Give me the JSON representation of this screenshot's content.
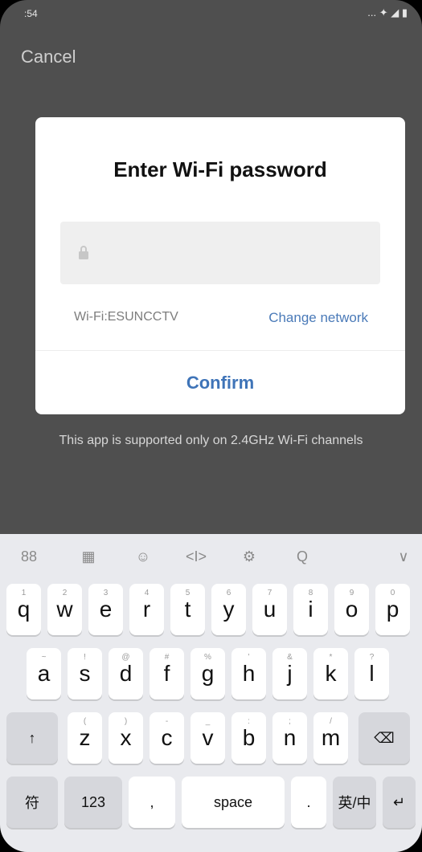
{
  "status": {
    "time": ":54",
    "right": "... ✦ ◢ ▮"
  },
  "top": {
    "cancel": "Cancel"
  },
  "dialog": {
    "title": "Enter Wi-Fi password",
    "password_placeholder": "",
    "wifi_label": "Wi-Fi:ESUNCCTV",
    "change_network": "Change network",
    "confirm": "Confirm"
  },
  "notice": "This app is supported only on 2.4GHz Wi-Fi channels",
  "keyboard": {
    "tools": [
      "88",
      "▦",
      "☺",
      "<I>",
      "⚙",
      "Q",
      "∨"
    ],
    "row1": [
      {
        "hint": "1",
        "label": "q"
      },
      {
        "hint": "2",
        "label": "w"
      },
      {
        "hint": "3",
        "label": "e"
      },
      {
        "hint": "4",
        "label": "r"
      },
      {
        "hint": "5",
        "label": "t"
      },
      {
        "hint": "6",
        "label": "y"
      },
      {
        "hint": "7",
        "label": "u"
      },
      {
        "hint": "8",
        "label": "i"
      },
      {
        "hint": "9",
        "label": "o"
      },
      {
        "hint": "0",
        "label": "p"
      }
    ],
    "row2": [
      {
        "hint": "~",
        "label": "a"
      },
      {
        "hint": "!",
        "label": "s"
      },
      {
        "hint": "@",
        "label": "d"
      },
      {
        "hint": "#",
        "label": "f"
      },
      {
        "hint": "%",
        "label": "g"
      },
      {
        "hint": "'",
        "label": "h"
      },
      {
        "hint": "&",
        "label": "j"
      },
      {
        "hint": "*",
        "label": "k"
      },
      {
        "hint": "?",
        "label": "l"
      }
    ],
    "row3": [
      {
        "hint": "",
        "label": "↑"
      },
      {
        "hint": "(",
        "label": "z"
      },
      {
        "hint": ")",
        "label": "x"
      },
      {
        "hint": "-",
        "label": "c"
      },
      {
        "hint": "_",
        "label": "v"
      },
      {
        "hint": ":",
        "label": "b"
      },
      {
        "hint": ";",
        "label": "n"
      },
      {
        "hint": "/",
        "label": "m"
      },
      {
        "hint": "",
        "label": "⌫"
      }
    ],
    "row4": [
      {
        "label": "符"
      },
      {
        "label": "123"
      },
      {
        "label": ","
      },
      {
        "label": "space"
      },
      {
        "label": "."
      },
      {
        "label": "英/中"
      },
      {
        "label": "↵"
      }
    ]
  }
}
